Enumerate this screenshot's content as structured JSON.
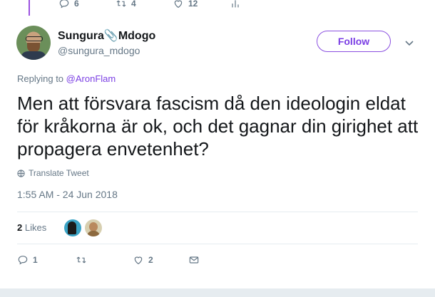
{
  "previous_tweet": {
    "reply_count": "6",
    "retweet_count": "4",
    "like_count": "12"
  },
  "author": {
    "display_name": "Sungura📎Mdogo",
    "handle": "@sungura_mdogo"
  },
  "follow_label": "Follow",
  "replying_to": {
    "prefix": "Replying to ",
    "user": "@AronFlam"
  },
  "tweet_text": "Men att försvara fascism då den ideologin eldat för kråkorna är ok, och det gagnar din girighet att propagera envetenhet?",
  "translate_label": "Translate Tweet",
  "timestamp": "1:55 AM - 24 Jun 2018",
  "likes": {
    "count": "2",
    "label": " Likes"
  },
  "actions": {
    "reply_count": "1",
    "like_count": "2"
  },
  "colors": {
    "accent": "#7b3fe4",
    "thread_line": "#9b51e0",
    "muted": "#657786"
  }
}
